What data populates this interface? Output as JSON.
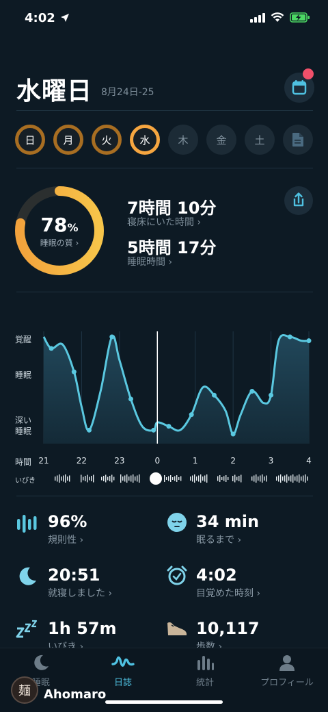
{
  "status": {
    "time": "4:02"
  },
  "header": {
    "title": "水曜日",
    "date_range": "8月24日-25"
  },
  "days": [
    "日",
    "月",
    "火",
    "水",
    "木",
    "金",
    "土"
  ],
  "summary": {
    "quality_value": "78",
    "quality_unit": "%",
    "quality_label": "睡眠の質 ›",
    "quality_fraction": 0.78,
    "time_in_bed": "7時間 10分",
    "time_in_bed_label": "寝床にいた時間 ›",
    "sleep_time": "5時間 17分",
    "sleep_time_label": "睡眠時間 ›"
  },
  "chart_data": {
    "type": "area",
    "y_levels": [
      "覚醒",
      "睡眠",
      "深い睡眠"
    ],
    "x_ticks": [
      "21",
      "22",
      "23",
      "0",
      "1",
      "2",
      "3",
      "4"
    ],
    "x_axis_label": "時間",
    "snore_label": "いびき",
    "x": [
      21.0,
      21.2,
      21.5,
      21.8,
      22.0,
      22.2,
      22.5,
      22.8,
      23.0,
      23.3,
      23.6,
      23.9,
      24.0,
      24.3,
      24.6,
      24.9,
      25.2,
      25.5,
      25.8,
      26.0,
      26.2,
      26.5,
      26.8,
      27.0,
      27.2,
      27.5,
      27.8,
      28.0
    ],
    "depth": [
      0.0,
      0.3,
      0.2,
      0.9,
      1.8,
      2.4,
      1.4,
      0.0,
      0.6,
      1.6,
      2.3,
      2.4,
      2.2,
      2.3,
      2.4,
      2.0,
      1.3,
      1.5,
      1.9,
      2.5,
      2.0,
      1.4,
      1.7,
      1.5,
      0.1,
      0.0,
      0.1,
      0.1
    ],
    "colors": {
      "line": "#5ac8e0",
      "fill": "#1b3b4a"
    }
  },
  "stats": [
    {
      "value": "96%",
      "label": "規則性 ›",
      "icon": "bars-icon"
    },
    {
      "value": "34 min",
      "label": "眠るまで ›",
      "icon": "sleepy-face-icon"
    },
    {
      "value": "20:51",
      "label": "就寝しました ›",
      "icon": "moon-icon"
    },
    {
      "value": "4:02",
      "label": "目覚めた時刻 ›",
      "icon": "alarm-clock-icon"
    },
    {
      "value": "1h 57m",
      "label": "いびき ›",
      "icon": "zzz-icon"
    },
    {
      "value": "10,117",
      "label": "歩数 ›",
      "icon": "shoe-icon"
    }
  ],
  "tabs": [
    {
      "label": "睡眠",
      "active": false
    },
    {
      "label": "日誌",
      "active": true
    },
    {
      "label": "統計",
      "active": false
    },
    {
      "label": "プロフィール",
      "active": false
    }
  ],
  "overlay": {
    "username": "Ahomaro",
    "avatar_text": "麺"
  }
}
